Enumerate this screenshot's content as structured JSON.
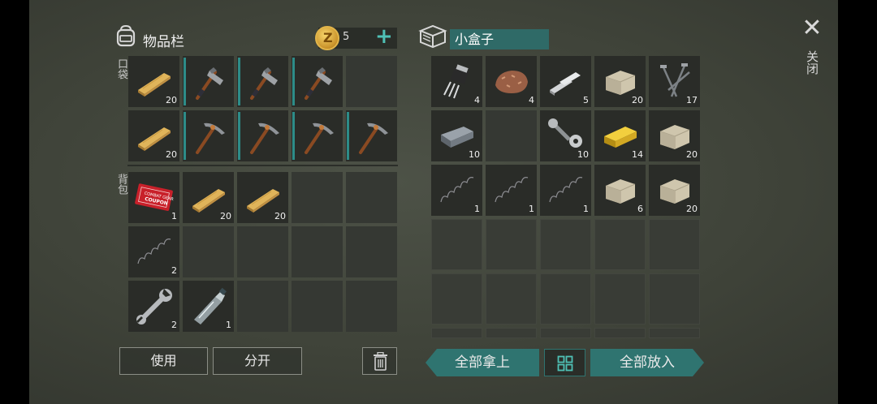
{
  "inventory": {
    "title": "物品栏",
    "pocket_label": "口袋",
    "backpack_label": "背包"
  },
  "currency": {
    "count": "5",
    "coin_glyph": "Z",
    "add_glyph": "+"
  },
  "container": {
    "title": "小盒子"
  },
  "close": {
    "glyph": "✕",
    "label": "关闭"
  },
  "pocket_slots": [
    {
      "item": "wood-plank",
      "qty": "20"
    },
    {
      "item": "hatchet",
      "qty": "",
      "durability": true
    },
    {
      "item": "hatchet",
      "qty": "",
      "durability": true
    },
    {
      "item": "hatchet",
      "qty": "",
      "durability": true
    },
    {
      "item": "",
      "qty": ""
    },
    {
      "item": "wood-plank",
      "qty": "20"
    },
    {
      "item": "pickaxe",
      "qty": "",
      "durability": true
    },
    {
      "item": "pickaxe",
      "qty": "",
      "durability": true
    },
    {
      "item": "pickaxe",
      "qty": "",
      "durability": true
    },
    {
      "item": "pickaxe",
      "qty": "",
      "durability": true
    }
  ],
  "backpack_slots": [
    {
      "item": "combat-coupon",
      "qty": "1",
      "coupon_text": [
        "COMBAT GEAR",
        "COUPON"
      ]
    },
    {
      "item": "wood-plank",
      "qty": "20"
    },
    {
      "item": "wood-plank",
      "qty": "20"
    },
    {
      "item": "",
      "qty": ""
    },
    {
      "item": "",
      "qty": ""
    },
    {
      "item": "spring",
      "qty": "2"
    },
    {
      "item": "",
      "qty": ""
    },
    {
      "item": "",
      "qty": ""
    },
    {
      "item": "",
      "qty": ""
    },
    {
      "item": "",
      "qty": ""
    },
    {
      "item": "wrench",
      "qty": "2"
    },
    {
      "item": "plastic-bottle",
      "qty": "1"
    },
    {
      "item": "",
      "qty": ""
    },
    {
      "item": "",
      "qty": ""
    },
    {
      "item": "",
      "qty": ""
    }
  ],
  "box_slots": [
    {
      "item": "transistor",
      "qty": "4"
    },
    {
      "item": "iron-ore",
      "qty": "4"
    },
    {
      "item": "scrap-metal",
      "qty": "5"
    },
    {
      "item": "stone",
      "qty": "20"
    },
    {
      "item": "nails",
      "qty": "17"
    },
    {
      "item": "metal-ingot",
      "qty": "10"
    },
    {
      "item": "",
      "qty": ""
    },
    {
      "item": "bolt-nut",
      "qty": "10"
    },
    {
      "item": "gold-bar",
      "qty": "14"
    },
    {
      "item": "stone",
      "qty": "20"
    },
    {
      "item": "spring",
      "qty": "1"
    },
    {
      "item": "spring",
      "qty": "1"
    },
    {
      "item": "spring",
      "qty": "1"
    },
    {
      "item": "stone",
      "qty": "6"
    },
    {
      "item": "stone",
      "qty": "20"
    }
  ],
  "buttons": {
    "use": "使用",
    "split": "分开",
    "take_all": "全部拿上",
    "put_all": "全部放入",
    "grid_glyph": "⊞"
  },
  "colors": {
    "accent": "#2f7470",
    "accent_text": "#4fc1b6",
    "slot": "#2a2c28"
  }
}
